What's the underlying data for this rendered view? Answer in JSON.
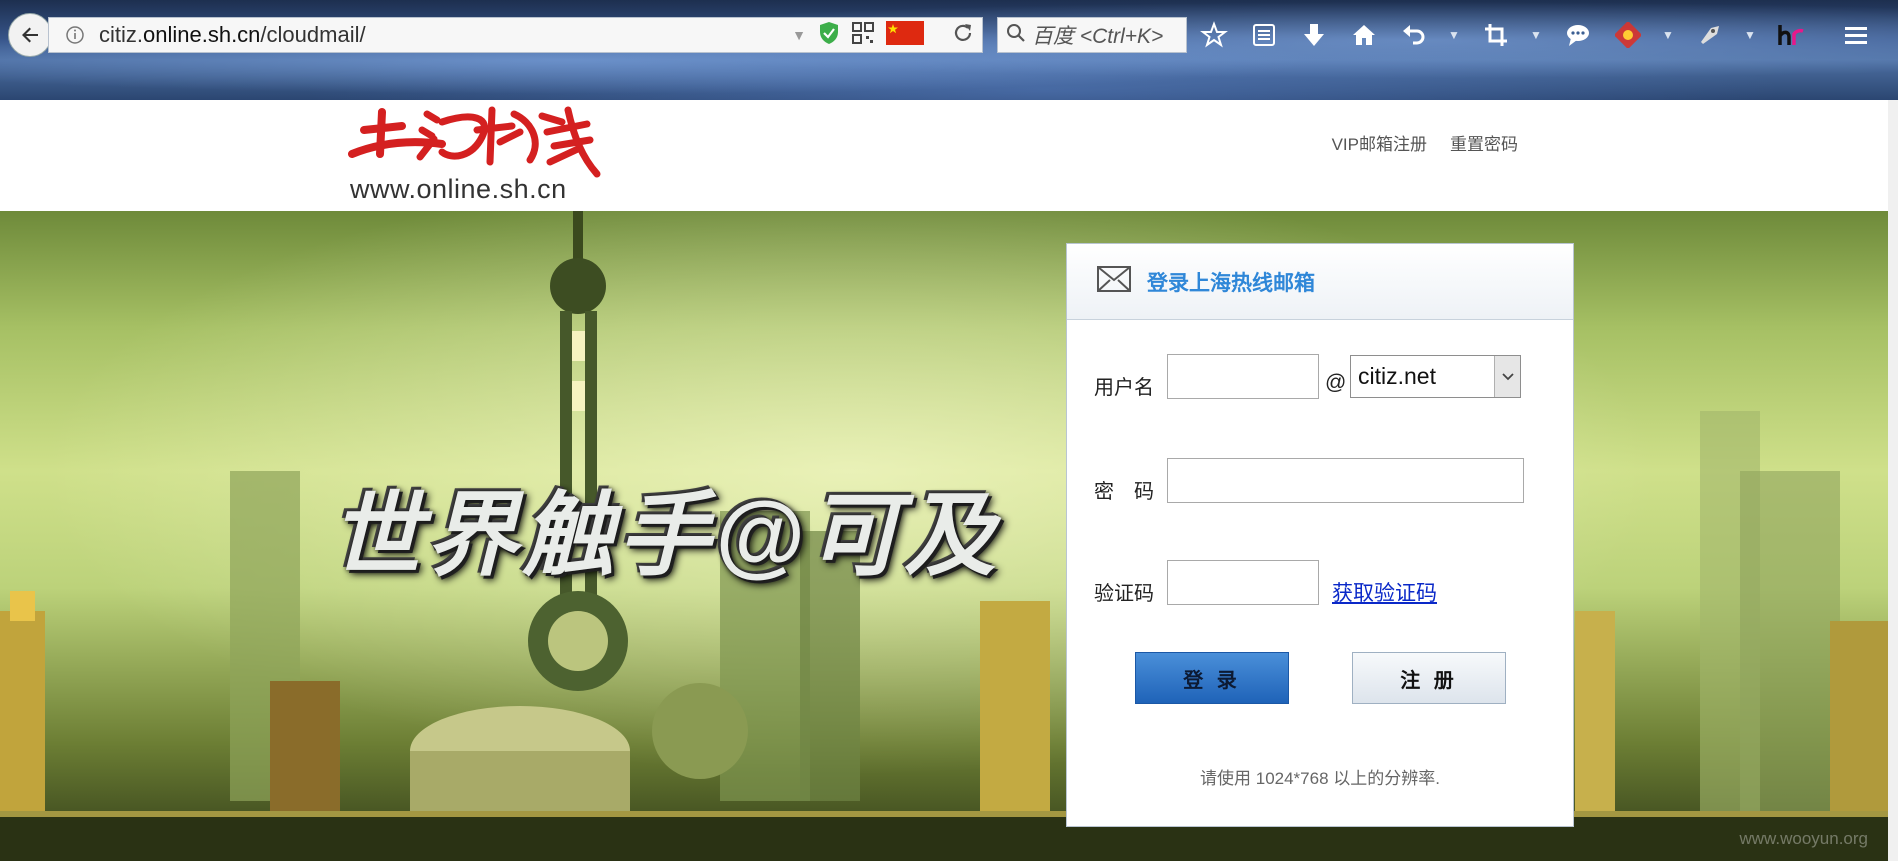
{
  "browser": {
    "url_plain_prefix": "citiz.",
    "url_host": "online.sh.cn",
    "url_path": "/cloudmail/",
    "search_placeholder": "百度 <Ctrl+K>",
    "accent": "#3c5f93"
  },
  "header": {
    "logo_text": "www.online.sh.cn",
    "links": [
      "VIP邮箱注册",
      "重置密码"
    ]
  },
  "banner": {
    "slogan": "世界触手@可及",
    "watermark": "www.wooyun.org"
  },
  "login": {
    "title": "登录上海热线邮箱",
    "username_label": "用户名",
    "at_symbol": "@",
    "domain_selected": "citiz.net",
    "password_label": "密　码",
    "captcha_label": "验证码",
    "get_code_link": "获取验证码",
    "login_button": "登 录",
    "register_button": "注 册",
    "resolution_note": "请使用 1024*768 以上的分辨率.",
    "colors": {
      "title": "#2f87d8",
      "link": "#0a28c8",
      "login_button": "#2a6fc4"
    }
  }
}
